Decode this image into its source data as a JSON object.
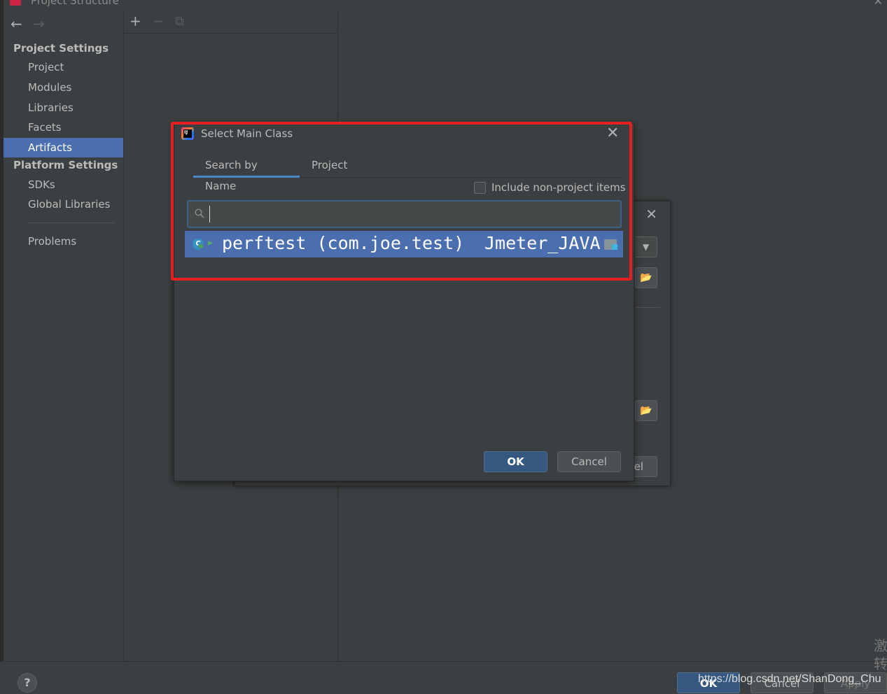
{
  "window": {
    "title": "Project Structure"
  },
  "nav": {
    "back_icon": "←",
    "forward_icon": "→"
  },
  "sidebar": {
    "project_settings_header": "Project Settings",
    "platform_settings_header": "Platform Settings",
    "items": [
      {
        "label": "Project"
      },
      {
        "label": "Modules"
      },
      {
        "label": "Libraries"
      },
      {
        "label": "Facets"
      },
      {
        "label": "Artifacts",
        "selected": true
      },
      {
        "label": "SDKs"
      },
      {
        "label": "Global Libraries"
      },
      {
        "label": "Problems"
      }
    ]
  },
  "toolbar": {
    "add_icon": "+",
    "remove_icon": "−",
    "copy_icon": "⧉"
  },
  "background_dialog": {
    "close_icon": "✕",
    "dropdown_icon": "▼",
    "folder_icon": "📂",
    "cancel_label_fragment": "el"
  },
  "dialog": {
    "title": "Select Main Class",
    "close_icon": "✕",
    "tabs": [
      {
        "label": "Search by Name",
        "active": true
      },
      {
        "label": "Project",
        "active": false
      }
    ],
    "include_non_project_label": "Include non-project items",
    "include_non_project_checked": false,
    "search": {
      "value": "",
      "placeholder": ""
    },
    "results": [
      {
        "name": "perftest (com.joe.test)",
        "module": "Jmeter_JAVA"
      }
    ],
    "ok_label": "OK",
    "cancel_label": "Cancel"
  },
  "bottom": {
    "help_label": "?",
    "ok_label": "OK",
    "cancel_label": "Cancel",
    "apply_label": "Apply",
    "watermark": "https://blog.csdn.net/ShanDong_Chu",
    "side_chars": "激转"
  },
  "colors": {
    "background": "#3c3f41",
    "selection": "#4b6eaf",
    "primary_button": "#365880",
    "highlight_border": "#e62020"
  }
}
